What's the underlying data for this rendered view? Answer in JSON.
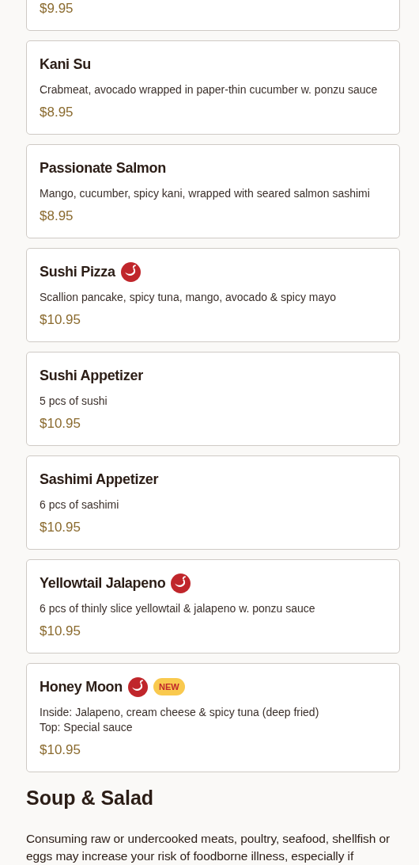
{
  "items": [
    {
      "price": "$9.95"
    },
    {
      "name": "Kani Su",
      "description": "Crabmeat, avocado wrapped in paper-thin cucumber w. ponzu sauce",
      "price": "$8.95",
      "spicy": false
    },
    {
      "name": "Passionate Salmon",
      "description": "Mango, cucumber, spicy kani, wrapped with seared salmon sashimi",
      "price": "$8.95",
      "spicy": false
    },
    {
      "name": "Sushi Pizza",
      "description": "Scallion pancake, spicy tuna, mango, avocado & spicy mayo",
      "price": "$10.95",
      "spicy": true
    },
    {
      "name": "Sushi Appetizer",
      "description": "5 pcs of sushi",
      "price": "$10.95",
      "spicy": false
    },
    {
      "name": "Sashimi Appetizer",
      "description": "6 pcs of sashimi",
      "price": "$10.95",
      "spicy": false
    },
    {
      "name": "Yellowtail Jalapeno",
      "description": "6 pcs of thinly slice yellowtail & jalapeno w. ponzu sauce",
      "price": "$10.95",
      "spicy": true
    },
    {
      "name": "Honey Moon",
      "description": "Inside: Jalapeno, cream cheese & spicy tuna (deep fried)\nTop: Special sauce",
      "price": "$10.95",
      "spicy": true,
      "badge": "NEW"
    }
  ],
  "section": {
    "title": "Soup & Salad",
    "notice": "Consuming raw or undercooked meats, poultry, seafood, shellfish or eggs may increase your risk of foodborne illness, especially if"
  }
}
